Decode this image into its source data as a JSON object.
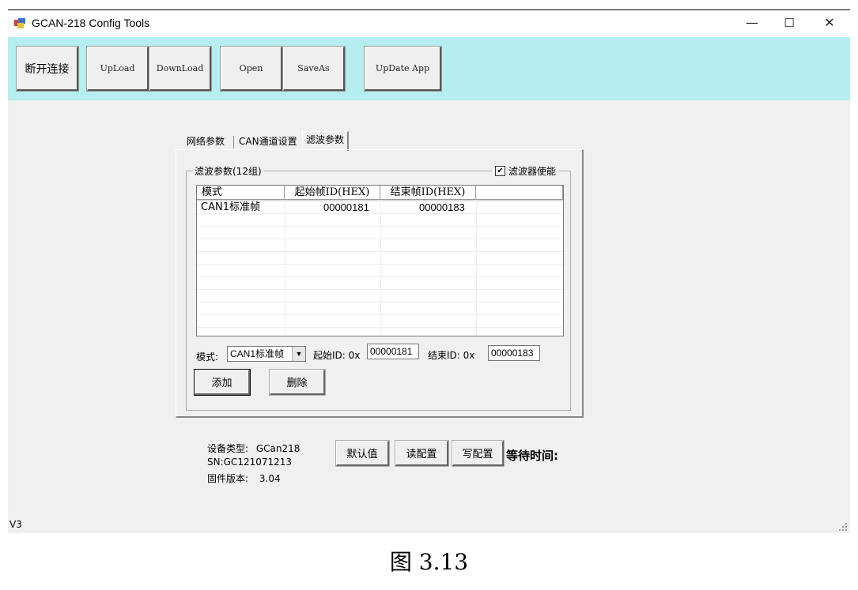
{
  "window": {
    "title": "GCAN-218 Config Tools",
    "min_glyph": "—",
    "max_glyph": "☐",
    "close_glyph": "✕"
  },
  "toolbar": {
    "disconnect": "断开连接",
    "upload": "UpLoad",
    "download": "DownLoad",
    "open": "Open",
    "saveas": "SaveAs",
    "update": "UpDate App"
  },
  "tabs": [
    "网络参数",
    "CAN通道设置",
    "滤波参数"
  ],
  "filter": {
    "group_label": "滤波参数(12组)",
    "enable_label": "滤波器使能",
    "enable_checked": true,
    "columns": [
      "模式",
      "起始帧ID(HEX)",
      "结束帧ID(HEX)",
      ""
    ],
    "rows": [
      {
        "mode": "CAN1标准帧",
        "start": "00000181",
        "end": "00000183"
      }
    ],
    "mode_label": "模式:",
    "mode_value": "CAN1标准帧",
    "start_label": "起始ID: 0x",
    "start_value": "00000181",
    "end_label": "结束ID: 0x",
    "end_value": "00000183",
    "add_btn": "添加",
    "delete_btn": "删除"
  },
  "device": {
    "type_label": "设备类型:",
    "type_value": "GCan218",
    "sn": "SN:GC121071213",
    "fw_label": "固件版本:",
    "fw_value": "3.04"
  },
  "actions": {
    "default_btn": "默认值",
    "read_btn": "读配置",
    "write_btn": "写配置",
    "wait_label": "等待时间:"
  },
  "status": {
    "version": "V3"
  },
  "caption": "图 3.13",
  "colors": {
    "toolbar_bg": "#b4eef0",
    "window_bg": "#f0f0f0"
  }
}
